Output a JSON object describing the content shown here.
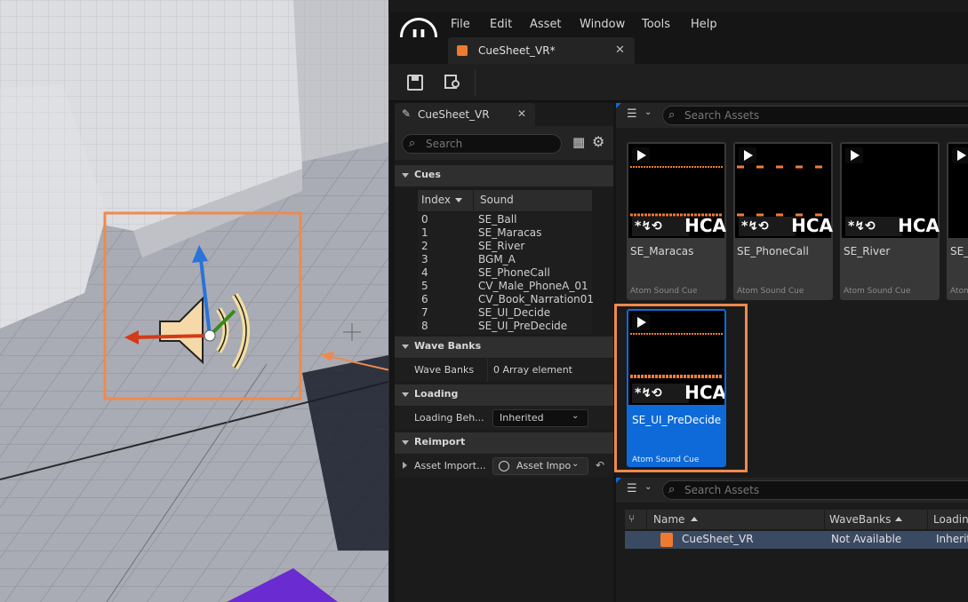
{
  "menu": {
    "file": "File",
    "edit": "Edit",
    "asset": "Asset",
    "window": "Window",
    "tools": "Tools",
    "help": "Help"
  },
  "document_tab": {
    "title": "CueSheet_VR*"
  },
  "details": {
    "tab_title": "CueSheet_VR",
    "search_placeholder": "Search",
    "sections": {
      "cues": "Cues",
      "wave_banks": "Wave Banks",
      "loading": "Loading",
      "reimport": "Reimport"
    },
    "cue_columns": {
      "index": "Index",
      "sound": "Sound"
    },
    "cues": [
      {
        "index": "0",
        "sound": "SE_Ball"
      },
      {
        "index": "1",
        "sound": "SE_Maracas"
      },
      {
        "index": "2",
        "sound": "SE_River"
      },
      {
        "index": "3",
        "sound": "BGM_A"
      },
      {
        "index": "4",
        "sound": "SE_PhoneCall"
      },
      {
        "index": "5",
        "sound": "CV_Male_PhoneA_01"
      },
      {
        "index": "6",
        "sound": "CV_Book_Narration01"
      },
      {
        "index": "7",
        "sound": "SE_UI_Decide"
      },
      {
        "index": "8",
        "sound": "SE_UI_PreDecide"
      }
    ],
    "wave_banks": {
      "label": "Wave Banks",
      "value": "0 Array element"
    },
    "loading": {
      "label": "Loading Beh...",
      "value": "Inherited"
    },
    "reimport": {
      "label": "Asset Import...",
      "value": "Asset Impo"
    }
  },
  "assets": {
    "search_placeholder": "Search Assets",
    "codec": "HCA",
    "tiles": [
      {
        "name": "SE_Maracas",
        "type": "Atom Sound Cue"
      },
      {
        "name": "SE_PhoneCall",
        "type": "Atom Sound Cue"
      },
      {
        "name": "SE_River",
        "type": "Atom Sound Cue"
      },
      {
        "name": "SE_",
        "type": "Atom"
      },
      {
        "name": "SE_UI_PreDecide",
        "type": "Atom Sound Cue"
      }
    ]
  },
  "asset_list": {
    "search_placeholder": "Search Assets",
    "columns": {
      "name": "Name",
      "wavebanks": "WaveBanks",
      "loading": "Loadin"
    },
    "rows": [
      {
        "name": "CueSheet_VR",
        "wavebanks": "Not Available",
        "loading": "Inherit"
      }
    ]
  },
  "colors": {
    "accent": "#0d6ad8",
    "highlight": "#ee8a4e",
    "waveform": "#f07d3a"
  }
}
